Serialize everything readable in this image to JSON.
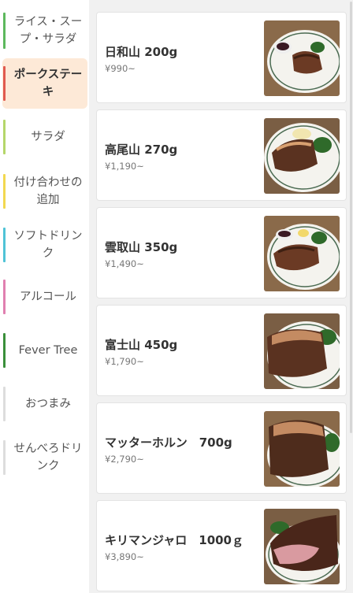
{
  "sidebar": {
    "items": [
      {
        "label": "ライス・スープ・サラダ",
        "color": "#5cb85c"
      },
      {
        "label": "ポークステーキ",
        "color": "#e05a4f",
        "active": true
      },
      {
        "label": "サラダ",
        "color": "#b5d66a"
      },
      {
        "label": "付け合わせの追加",
        "color": "#f2d84f"
      },
      {
        "label": "ソフトドリンク",
        "color": "#4fc3d6"
      },
      {
        "label": "アルコール",
        "color": "#e080b0"
      },
      {
        "label": "Fever Tree",
        "color": "#3a8f3a"
      },
      {
        "label": "おつまみ",
        "color": "#dddddd"
      },
      {
        "label": "せんべろドリンク",
        "color": "#dddddd"
      }
    ]
  },
  "menu": {
    "items": [
      {
        "name": "日和山 200g",
        "price": "¥990~",
        "photo": "steak-200g-photo"
      },
      {
        "name": "高尾山 270g",
        "price": "¥1,190~",
        "photo": "steak-270g-photo"
      },
      {
        "name": "雲取山 350g",
        "price": "¥1,490~",
        "photo": "steak-350g-photo"
      },
      {
        "name": "富士山 450g",
        "price": "¥1,790~",
        "photo": "steak-450g-photo"
      },
      {
        "name": "マッターホルン　700g",
        "price": "¥2,790~",
        "photo": "steak-700g-photo"
      },
      {
        "name": "キリマンジャロ　1000ｇ",
        "price": "¥3,890~",
        "photo": "steak-1000g-photo"
      }
    ]
  },
  "colors": {
    "active_bg": "#fde9d7",
    "card_bg": "#ffffff",
    "page_bg": "#f1f1f1"
  }
}
